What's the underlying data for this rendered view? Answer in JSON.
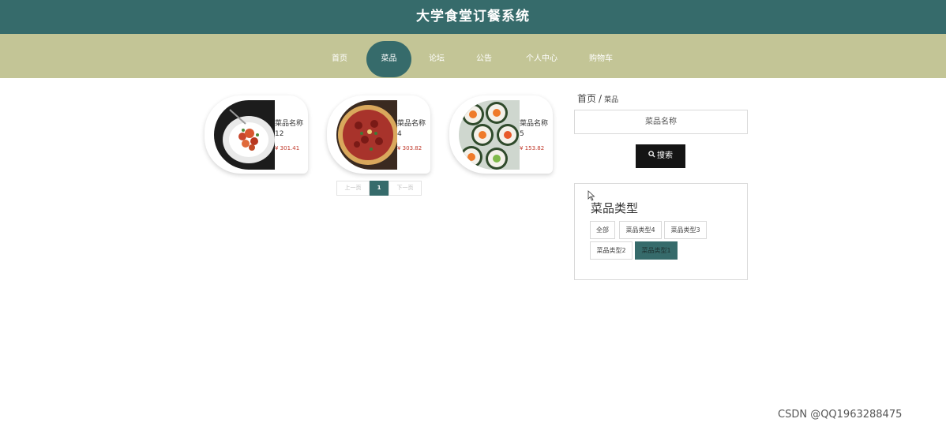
{
  "header": {
    "title": "大学食堂订餐系统"
  },
  "nav": {
    "items": [
      {
        "label": "首页"
      },
      {
        "label": "菜品"
      },
      {
        "label": "论坛"
      },
      {
        "label": "公告"
      },
      {
        "label": "个人中心"
      },
      {
        "label": "购物车"
      }
    ],
    "active_label": "菜品"
  },
  "dishes": [
    {
      "name": "菜品名称12",
      "price": "¥ 301.41",
      "image": "plated-dish"
    },
    {
      "name": "菜品名称4",
      "price": "¥ 303.82",
      "image": "pizza"
    },
    {
      "name": "菜品名称5",
      "price": "¥ 153.82",
      "image": "sushi"
    }
  ],
  "pagination": {
    "prev": "上一页",
    "current": "1",
    "next": "下一页"
  },
  "breadcrumb": {
    "home": "首页",
    "separator": "/",
    "current": "菜品"
  },
  "search": {
    "placeholder": "菜品名称",
    "button": "搜索"
  },
  "categories": {
    "title": "菜品类型",
    "tags": [
      {
        "label": "全部"
      },
      {
        "label": "菜品类型4"
      },
      {
        "label": "菜品类型3"
      },
      {
        "label": "菜品类型2"
      },
      {
        "label": "菜品类型1"
      }
    ],
    "active_label": "菜品类型1"
  },
  "watermark": "CSDN @QQ1963288475",
  "colors": {
    "primary": "#366b6b",
    "nav_bg": "#c3c596",
    "price": "#c0392b"
  }
}
